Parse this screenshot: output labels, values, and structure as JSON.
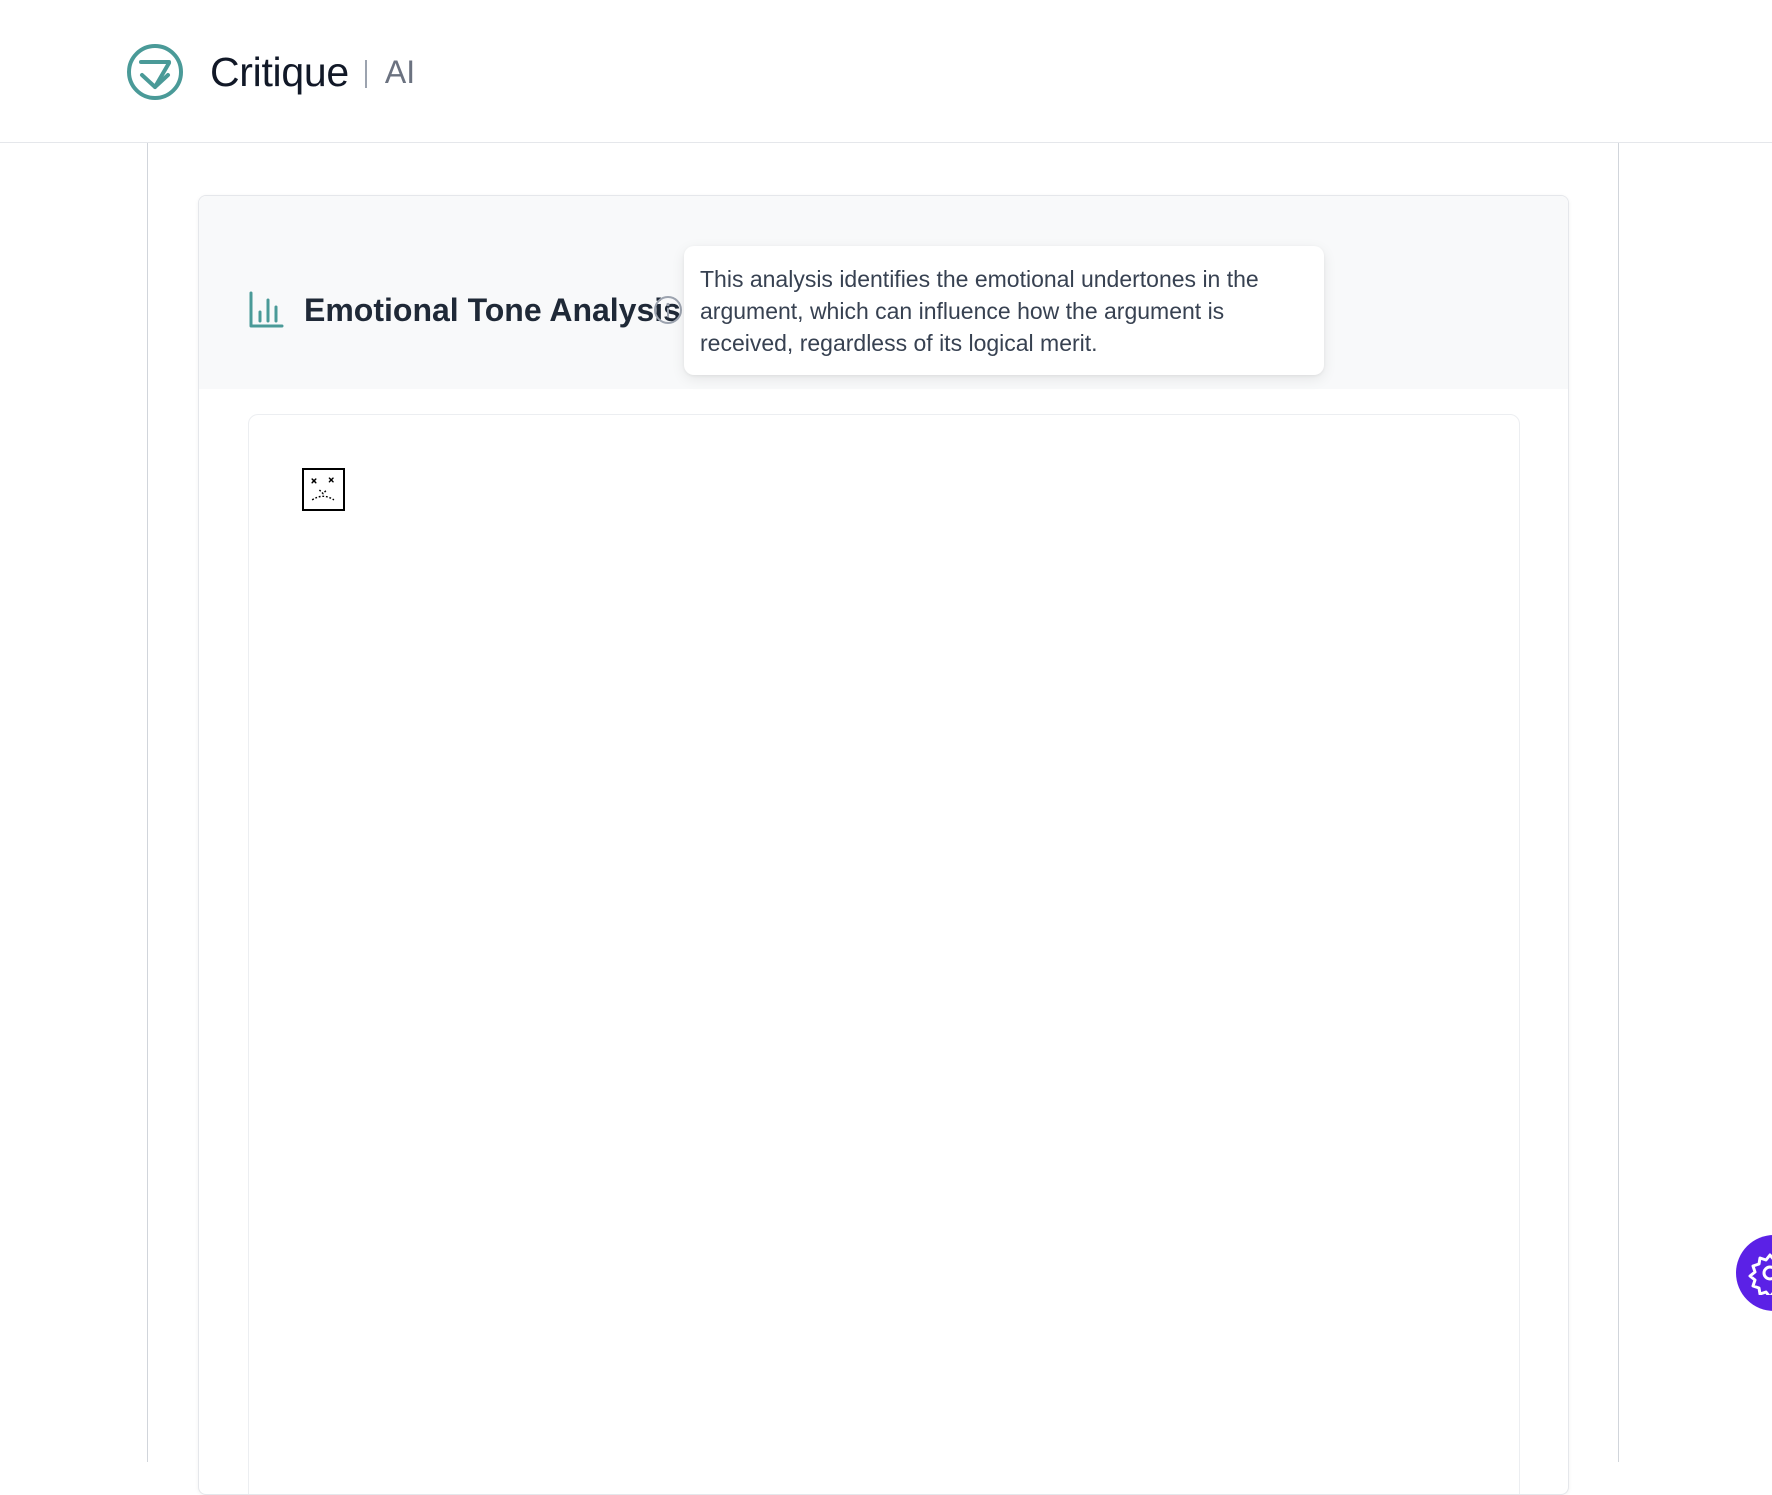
{
  "header": {
    "brand_name": "Critique",
    "brand_suffix": "AI"
  },
  "section": {
    "title": "Emotional Tone Analysis",
    "tooltip": "This analysis identifies the emotional undertones in the argument, which can influence how the argument is received, regardless of its logical merit."
  },
  "icons": {
    "logo": "critique-check-logo",
    "section": "bar-chart-icon",
    "info": "info-icon",
    "broken_image": "broken-image-icon",
    "fab": "gear-icon"
  },
  "colors": {
    "accent": "#4a9a98",
    "fab": "#5b21e6"
  }
}
